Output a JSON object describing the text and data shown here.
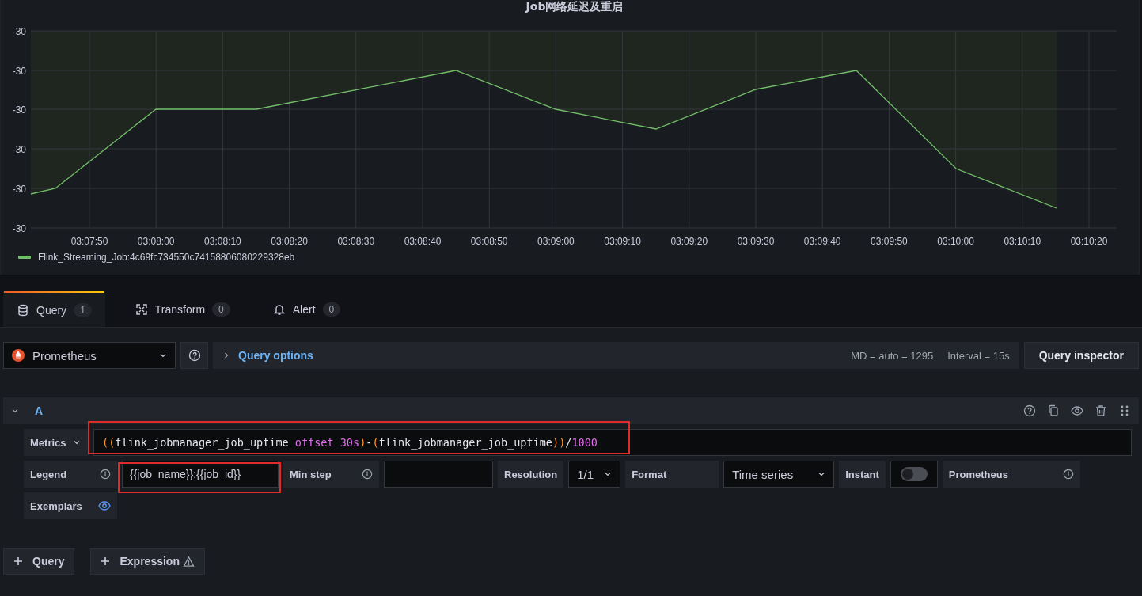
{
  "panel": {
    "title": "Job网络延迟及重启",
    "y_axis_labels": [
      "-30",
      "-30",
      "-30",
      "-30",
      "-30",
      "-30"
    ],
    "x_axis_labels": [
      "03:07:50",
      "03:08:00",
      "03:08:10",
      "03:08:20",
      "03:08:30",
      "03:08:40",
      "03:08:50",
      "03:09:00",
      "03:09:10",
      "03:09:20",
      "03:09:30",
      "03:09:40",
      "03:09:50",
      "03:10:00",
      "03:10:10",
      "03:10:20"
    ],
    "legend": [
      {
        "label": "Flink_Streaming_Job:4c69fc734550c74158806080229328eb",
        "color": "#73bf69"
      }
    ]
  },
  "tabs": [
    {
      "label": "Query",
      "count": "1",
      "selected": true
    },
    {
      "label": "Transform",
      "count": "0",
      "selected": false
    },
    {
      "label": "Alert",
      "count": "0",
      "selected": false
    }
  ],
  "datasource": {
    "name": "Prometheus"
  },
  "query_options": {
    "label": "Query options",
    "max_data_points": "MD = auto = 1295",
    "interval": "Interval = 15s"
  },
  "query_inspector": "Query inspector",
  "queries": [
    {
      "ref": "A",
      "expanded": true,
      "metrics_label": "Metrics",
      "metrics_highlighted": true,
      "expression": [
        {
          "text": "((",
          "kind": "paren"
        },
        {
          "text": "flink_jobmanager_job_uptime ",
          "kind": "ident"
        },
        {
          "text": "offset 30s",
          "kind": "keyword"
        },
        {
          "text": ")",
          "kind": "paren"
        },
        {
          "text": "-",
          "kind": "op"
        },
        {
          "text": "(",
          "kind": "paren"
        },
        {
          "text": "flink_jobmanager_job_uptime",
          "kind": "ident"
        },
        {
          "text": "))",
          "kind": "paren"
        },
        {
          "text": "/",
          "kind": "op"
        },
        {
          "text": "1000",
          "kind": "keyword"
        }
      ],
      "legend_label": "Legend",
      "legend_value": "{{job_name}}:{{job_id}}",
      "legend_highlighted": true,
      "min_step_label": "Min step",
      "resolution_label": "Resolution",
      "resolution": "1/1",
      "format_label": "Format",
      "format": "Time series",
      "instant_label": "Instant",
      "instant": false,
      "type_label": "Prometheus",
      "exemplars_label": "Exemplars",
      "exemplars": true
    }
  ],
  "add_buttons": [
    {
      "label": "Query",
      "warning": false
    },
    {
      "label": "Expression",
      "warning": true
    }
  ]
}
